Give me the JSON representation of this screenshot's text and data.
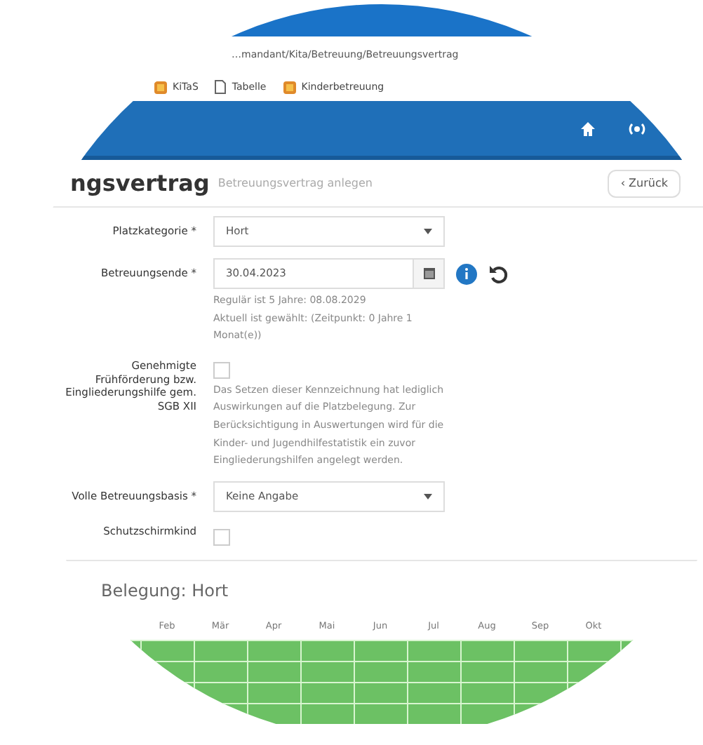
{
  "browser": {
    "address": "…mandant/Kita/Betreuung/Betreuungsvertrag",
    "bookmarks": [
      {
        "label": "KiTaS",
        "kind": "app"
      },
      {
        "label": "Tabelle",
        "kind": "page"
      },
      {
        "label": "Kinderbetreuung",
        "kind": "app"
      }
    ]
  },
  "page": {
    "title": "ngsvertrag",
    "subtitle": "Betreuungsvertrag anlegen",
    "back_button": "‹ Zurück"
  },
  "form": [
    {
      "kind": "select",
      "label": "Platzkategorie *",
      "value": "Hort"
    },
    {
      "kind": "date",
      "label": "Betreuungsende *",
      "value": "30.04.2023",
      "help": "Regulär ist 5 Jahre: 08.08.2029\nAktuell ist gewählt: (Zeitpunkt: 0 Jahre 1 Monat(e))"
    },
    {
      "kind": "checkbox",
      "label": "Genehmigte Frühförderung bzw. Eingliederungshilfe gem. SGB XII",
      "checked": false,
      "help": "Das Setzen dieser Kennzeichnung hat lediglich Auswirkungen auf die Platzbelegung. Zur Berücksichtigung in Auswertungen wird für die Kinder- und Jugendhilfestatistik ein zuvor Eingliederungshilfen angelegt werden."
    },
    {
      "kind": "select",
      "label": "Volle Betreuungsbasis *",
      "value": "Keine Angabe"
    },
    {
      "kind": "checkbox",
      "label": "Schutzschirmkind",
      "checked": false
    }
  ],
  "occupancy": {
    "title": "Belegung: Hort",
    "months": [
      "Feb",
      "Mär",
      "Apr",
      "Mai",
      "Jun",
      "Jul",
      "Aug",
      "Sep",
      "Okt"
    ]
  }
}
